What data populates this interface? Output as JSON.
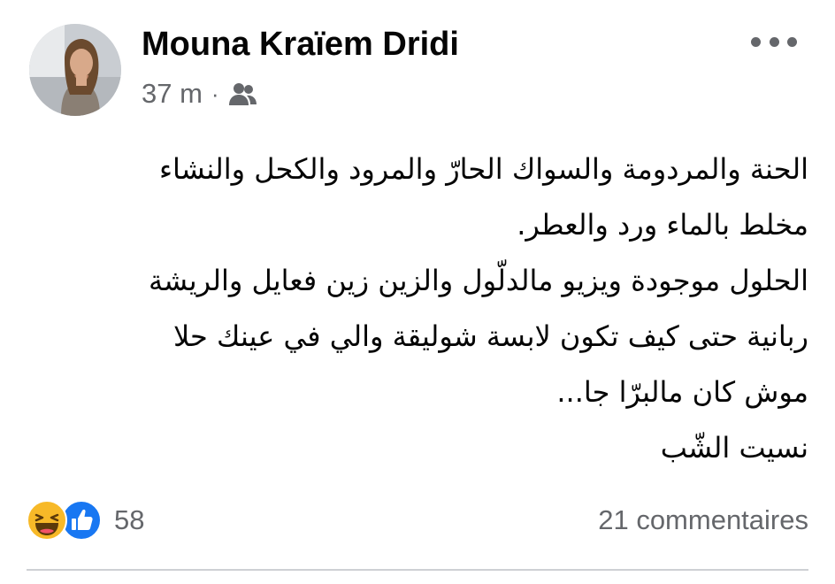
{
  "post": {
    "author": {
      "name": "Mouna Kraïem Dridi"
    },
    "meta": {
      "time": "37 m",
      "separator": "·",
      "audience_icon": "friends-icon"
    },
    "more_icon": "more-options-icon",
    "text_lines": [
      "الحنة والمردومة والسواك الحارّ والمرود والكحل والنشاء",
      "مخلط بالماء ورد والعطر.",
      "الحلول موجودة ويزيو مالدلّول والزين زين فعايل والريشة",
      "ربانية حتى كيف تكون لابسة شوليقة والي في عينك حلا",
      "موش كان مالبرّا جا...",
      "نسيت الشّب"
    ],
    "reactions": {
      "icons": [
        "haha-reaction-icon",
        "like-reaction-icon"
      ],
      "count": "58"
    },
    "comments": {
      "label": "21 commentaires"
    }
  },
  "colors": {
    "text_primary": "#050505",
    "text_secondary": "#65676b",
    "like_blue": "#1877f2",
    "haha_yellow": "#f7b928",
    "divider": "#ced0d4"
  }
}
